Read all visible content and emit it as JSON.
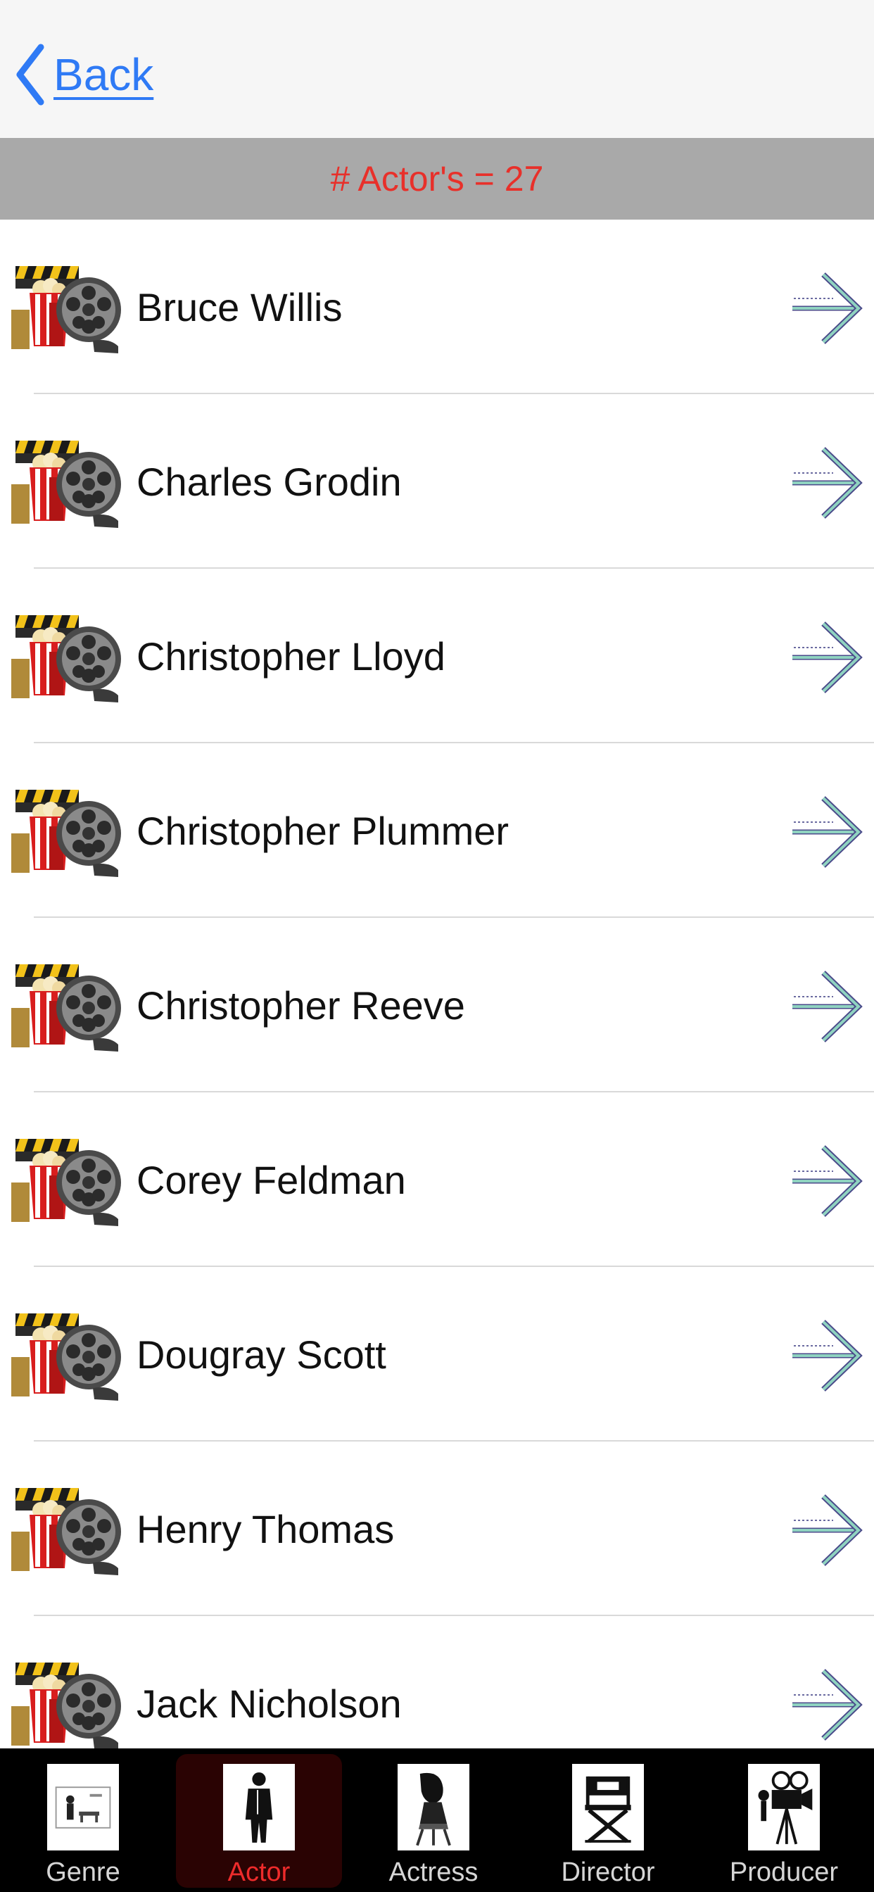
{
  "nav": {
    "back_label": "Back"
  },
  "header": {
    "count_text": "# Actor's = 27"
  },
  "actors": [
    "Bruce Willis",
    "Charles Grodin",
    "Christopher Lloyd",
    "Christopher Plummer",
    "Christopher Reeve",
    "Corey Feldman",
    "Dougray Scott",
    "Henry Thomas",
    "Jack Nicholson"
  ],
  "tabs": [
    {
      "label": "Genre",
      "icon": "genre-icon",
      "active": false
    },
    {
      "label": "Actor",
      "icon": "actor-icon",
      "active": true
    },
    {
      "label": "Actress",
      "icon": "actress-icon",
      "active": false
    },
    {
      "label": "Director",
      "icon": "director-chair-icon",
      "active": false
    },
    {
      "label": "Producer",
      "icon": "movie-camera-icon",
      "active": false
    }
  ],
  "colors": {
    "link": "#2f7af5",
    "count_text": "#e8302a",
    "count_bar": "#a9a9a9",
    "active_tab": "#ee2b2b",
    "tabbar": "#000000"
  }
}
